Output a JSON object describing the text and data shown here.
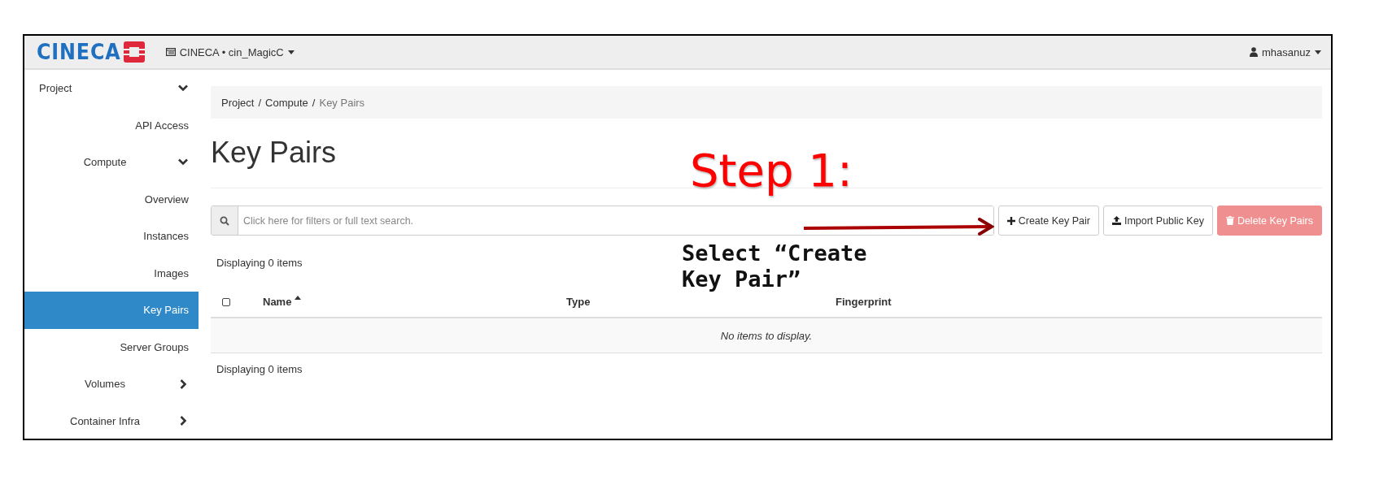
{
  "topbar": {
    "logo": "CINECA",
    "project_menu": "CINECA • cin_MagicC",
    "user_menu": "mhasanuz"
  },
  "sidebar": {
    "items": [
      {
        "label": "Project",
        "kind": "group",
        "expanded": true,
        "children": [
          {
            "label": "API Access",
            "kind": "link",
            "selected": false
          },
          {
            "label": "Compute",
            "kind": "group",
            "expanded": true,
            "children": [
              {
                "label": "Overview",
                "kind": "link",
                "selected": false
              },
              {
                "label": "Instances",
                "kind": "link",
                "selected": false
              },
              {
                "label": "Images",
                "kind": "link",
                "selected": false
              },
              {
                "label": "Key Pairs",
                "kind": "link",
                "selected": true
              },
              {
                "label": "Server Groups",
                "kind": "link",
                "selected": false
              }
            ]
          },
          {
            "label": "Volumes",
            "kind": "group",
            "expanded": false
          },
          {
            "label": "Container Infra",
            "kind": "group",
            "expanded": false
          }
        ]
      }
    ]
  },
  "breadcrumb": [
    {
      "label": "Project",
      "separator": "/",
      "current": false
    },
    {
      "label": "Compute",
      "separator": "/",
      "current": false
    },
    {
      "label": "Key Pairs",
      "current": true
    }
  ],
  "page_title": "Key Pairs",
  "search": {
    "placeholder": "Click here for filters or full text search."
  },
  "actions": [
    {
      "label": "Create Key Pair",
      "kind": "create",
      "disabled": false
    },
    {
      "label": "Import Public Key",
      "kind": "import",
      "disabled": false
    },
    {
      "label": "Delete Key Pairs",
      "kind": "delete",
      "disabled": true
    }
  ],
  "table": {
    "summary_top": "Displaying 0 items",
    "select_all": {
      "checked": false
    },
    "columns": [
      {
        "label": "Name",
        "sorted": true
      },
      {
        "label": "Type",
        "sorted": false
      },
      {
        "label": "Fingerprint",
        "sorted": false
      }
    ],
    "empty_message": "No items to display.",
    "summary_bottom": "Displaying 0 items"
  },
  "annotation": {
    "title": "Step 1:",
    "note": "Select “Create Key Pair”"
  }
}
